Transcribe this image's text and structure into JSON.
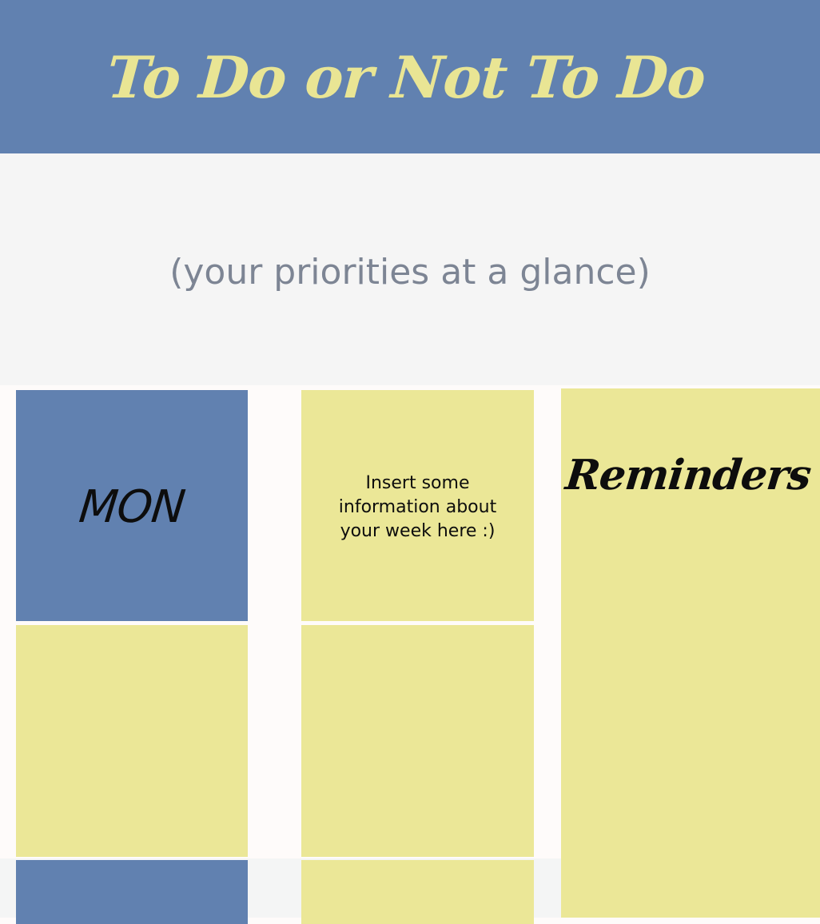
{
  "header": {
    "title": "To Do or Not To Do"
  },
  "subtitle": "(your priorities at a glance)",
  "planner": {
    "day_label": "MON",
    "info_text": "Insert some information about your week here :)",
    "reminders_title": "Reminders"
  },
  "colors": {
    "header_bg": "#6181b0",
    "header_text": "#e9e594",
    "subtitle_band_bg": "#f5f5f5",
    "subtitle_text": "#7d8594",
    "page_bg": "#fefbfa",
    "bottom_band_bg": "#f4f5f5",
    "blue_box": "#6181b0",
    "yellow_box": "#ebe797",
    "box_text": "#0d0d0d"
  }
}
